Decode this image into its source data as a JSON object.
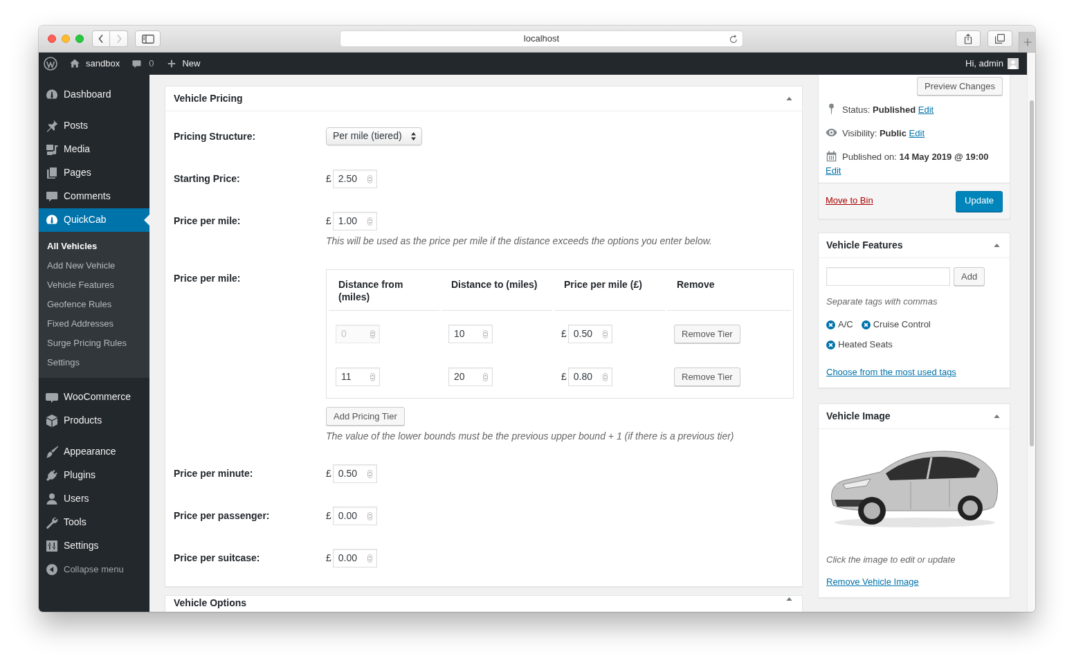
{
  "browser": {
    "address": "localhost",
    "nav_buttons": [
      {
        "kind": "back",
        "disabled": false
      },
      {
        "kind": "forward",
        "disabled": true
      }
    ]
  },
  "admin_bar": {
    "site": "sandbox",
    "comments": "0",
    "new": "New",
    "greeting": "Hi, admin"
  },
  "sidebar": {
    "groups": [
      {
        "items": [
          {
            "label": "Dashboard",
            "selected": false
          }
        ]
      },
      {
        "items": [
          {
            "label": "Posts",
            "selected": false
          },
          {
            "label": "Media",
            "selected": false
          },
          {
            "label": "Pages",
            "selected": false
          },
          {
            "label": "Comments",
            "selected": false
          },
          {
            "label": "QuickCab",
            "selected": true,
            "children": [
              {
                "label": "All Vehicles",
                "selected": true
              },
              {
                "label": "Add New Vehicle",
                "selected": false
              },
              {
                "label": "Vehicle Features",
                "selected": false
              },
              {
                "label": "Geofence Rules",
                "selected": false
              },
              {
                "label": "Fixed Addresses",
                "selected": false
              },
              {
                "label": "Surge Pricing Rules",
                "selected": false
              },
              {
                "label": "Settings",
                "selected": false
              }
            ]
          }
        ]
      },
      {
        "items": [
          {
            "label": "WooCommerce",
            "selected": false
          },
          {
            "label": "Products",
            "selected": false
          }
        ]
      },
      {
        "items": [
          {
            "label": "Appearance",
            "selected": false
          },
          {
            "label": "Plugins",
            "selected": false
          },
          {
            "label": "Users",
            "selected": false
          },
          {
            "label": "Tools",
            "selected": false
          },
          {
            "label": "Settings",
            "selected": false
          }
        ]
      }
    ],
    "collapse": "Collapse menu"
  },
  "pricing_box": {
    "title": "Vehicle Pricing",
    "expanded": true,
    "rows": [
      {
        "kind": "select",
        "label": "Pricing Structure:",
        "value": "Per mile (tiered)"
      },
      {
        "kind": "number",
        "label": "Starting Price:",
        "currency": "£",
        "value": "2.50"
      },
      {
        "kind": "number",
        "label": "Price per mile:",
        "currency": "£",
        "value": "1.00",
        "description": "This will be used as the price per mile if the distance exceeds the options you enter below."
      },
      {
        "kind": "tiers",
        "label": "Price per mile:",
        "columns": [
          "Distance from (miles)",
          "Distance to (miles)",
          "Price per mile (£)",
          "Remove"
        ],
        "tiers": [
          {
            "from": {
              "value": "0",
              "disabled": true
            },
            "to": "10",
            "currency": "£",
            "price": "0.50",
            "remove": "Remove Tier"
          },
          {
            "from": {
              "value": "11",
              "disabled": false
            },
            "to": "20",
            "currency": "£",
            "price": "0.80",
            "remove": "Remove Tier"
          }
        ],
        "add_button": "Add Pricing Tier",
        "description": "The value of the lower bounds must be the previous upper bound + 1 (if there is a previous tier)"
      },
      {
        "kind": "number",
        "label": "Price per minute:",
        "currency": "£",
        "value": "0.50"
      },
      {
        "kind": "number",
        "label": "Price per passenger:",
        "currency": "£",
        "value": "0.00"
      },
      {
        "kind": "number",
        "label": "Price per suitcase:",
        "currency": "£",
        "value": "0.00"
      }
    ]
  },
  "options_box": {
    "title": "Vehicle Options",
    "expanded": true
  },
  "publish_box": {
    "preview_button": "Preview Changes",
    "rows": [
      {
        "text": "Status: **Published**",
        "link": "Edit"
      },
      {
        "text": "Visibility: **Public**",
        "link": "Edit"
      },
      {
        "text": "Published on: **14 May 2019 @ 19:00**",
        "link": "Edit"
      }
    ],
    "delete_link": "Move to Bin",
    "update_button": "Update"
  },
  "features_box": {
    "title": "Vehicle Features",
    "expanded": true,
    "add_button": "Add",
    "hint": "Separate tags with commas",
    "tags": [
      {
        "label": "A/C"
      },
      {
        "label": "Cruise Control"
      },
      {
        "label": "Heated Seats"
      }
    ],
    "most_used_link": "Choose from the most used tags"
  },
  "image_box": {
    "title": "Vehicle Image",
    "expanded": true,
    "hint": "Click the image to edit or update",
    "remove_link": "Remove Vehicle Image"
  }
}
